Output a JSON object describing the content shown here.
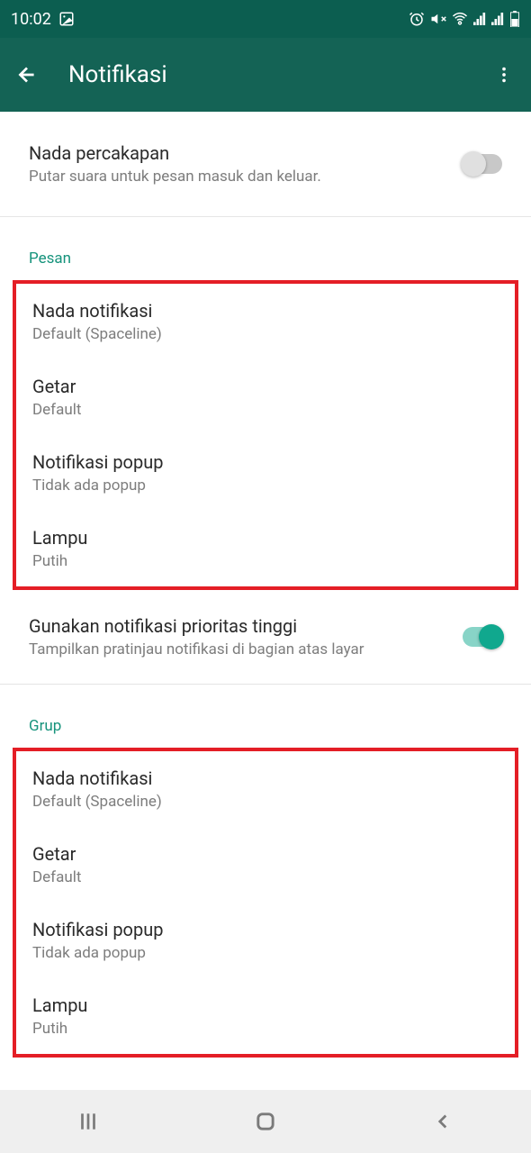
{
  "status_bar": {
    "time": "10:02"
  },
  "app_bar": {
    "title": "Notifikasi"
  },
  "conversation_sound": {
    "title": "Nada percakapan",
    "subtitle": "Putar suara untuk pesan masuk dan keluar."
  },
  "sections": {
    "pesan": {
      "header": "Pesan",
      "notification_sound": {
        "title": "Nada notifikasi",
        "subtitle": "Default (Spaceline)"
      },
      "vibrate": {
        "title": "Getar",
        "subtitle": "Default"
      },
      "popup": {
        "title": "Notifikasi popup",
        "subtitle": "Tidak ada popup"
      },
      "light": {
        "title": "Lampu",
        "subtitle": "Putih"
      },
      "priority": {
        "title": "Gunakan notifikasi prioritas tinggi",
        "subtitle": "Tampilkan pratinjau notifikasi di bagian atas layar"
      }
    },
    "grup": {
      "header": "Grup",
      "notification_sound": {
        "title": "Nada notifikasi",
        "subtitle": "Default (Spaceline)"
      },
      "vibrate": {
        "title": "Getar",
        "subtitle": "Default"
      },
      "popup": {
        "title": "Notifikasi popup",
        "subtitle": "Tidak ada popup"
      },
      "light": {
        "title": "Lampu",
        "subtitle": "Putih"
      }
    }
  }
}
